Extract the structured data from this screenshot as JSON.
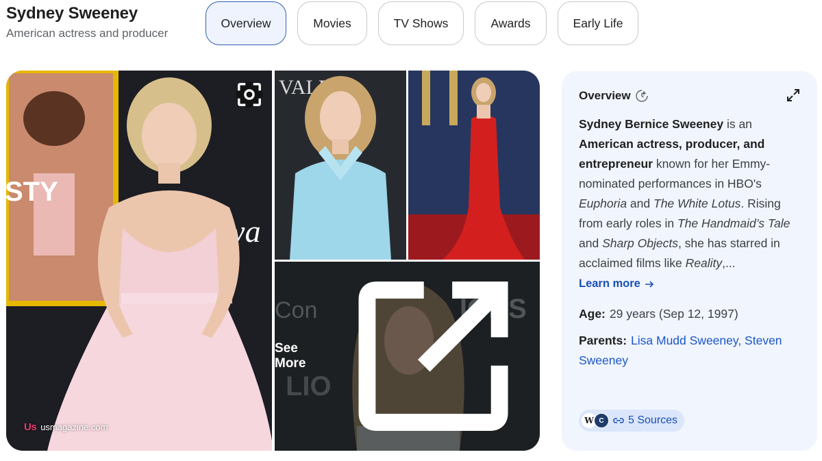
{
  "entity": {
    "name": "Sydney Sweeney",
    "description": "American actress and producer"
  },
  "tabs": [
    {
      "label": "Overview",
      "active": true
    },
    {
      "label": "Movies",
      "active": false
    },
    {
      "label": "TV Shows",
      "active": false
    },
    {
      "label": "Awards",
      "active": false
    },
    {
      "label": "Early Life",
      "active": false
    }
  ],
  "images": {
    "main_source": "usmagazine.com",
    "main_source_logo": "Us",
    "main_backdrop_text_1": "STY",
    "main_backdrop_text_2": "wa",
    "blue_backdrop_text": "VALE",
    "bottom_backdrop_text_1": "Con",
    "bottom_backdrop_text_2": "IONS",
    "bottom_backdrop_text_3": "LIO",
    "see_more_label": "See More",
    "lens_icon": "lens-icon",
    "external_icon": "external-link-icon"
  },
  "panel": {
    "title": "Overview",
    "title_icon": "ai-sparkle-icon",
    "expand_icon": "expand-icon",
    "summary": [
      {
        "text": "Sydney Bernice Sweeney",
        "style": "bold"
      },
      {
        "text": " is an ",
        "style": "normal"
      },
      {
        "text": "American actress, producer, and entrepreneur",
        "style": "bold"
      },
      {
        "text": " known for her Emmy-nominated performances in HBO's ",
        "style": "normal"
      },
      {
        "text": "Euphoria",
        "style": "italic"
      },
      {
        "text": " and ",
        "style": "normal"
      },
      {
        "text": "The White Lotus",
        "style": "italic"
      },
      {
        "text": ". Rising from early roles in ",
        "style": "normal"
      },
      {
        "text": "The Handmaid’s Tale",
        "style": "italic"
      },
      {
        "text": " and ",
        "style": "normal"
      },
      {
        "text": "Sharp Objects",
        "style": "italic"
      },
      {
        "text": ", she has starred in acclaimed films like ",
        "style": "normal"
      },
      {
        "text": "Reality",
        "style": "italic"
      },
      {
        "text": ",...",
        "style": "normal"
      }
    ],
    "learn_more": "Learn more",
    "learn_more_icon": "arrow-right-icon",
    "facts": {
      "age_label": "Age:",
      "age_value": "29 years (Sep 12, 1997)",
      "parents_label": "Parents:",
      "parents_value": "Lisa Mudd Sweeney, Steven Sweeney"
    },
    "sources": {
      "count_label": "5 Sources",
      "favicon_1": "W",
      "favicon_2": "C",
      "link_icon": "link-icon"
    }
  },
  "colors": {
    "active_tab_bg": "#eef3fd",
    "active_tab_border": "#2f5fb3",
    "panel_bg": "#f1f5fd",
    "link": "#1a56c7"
  }
}
